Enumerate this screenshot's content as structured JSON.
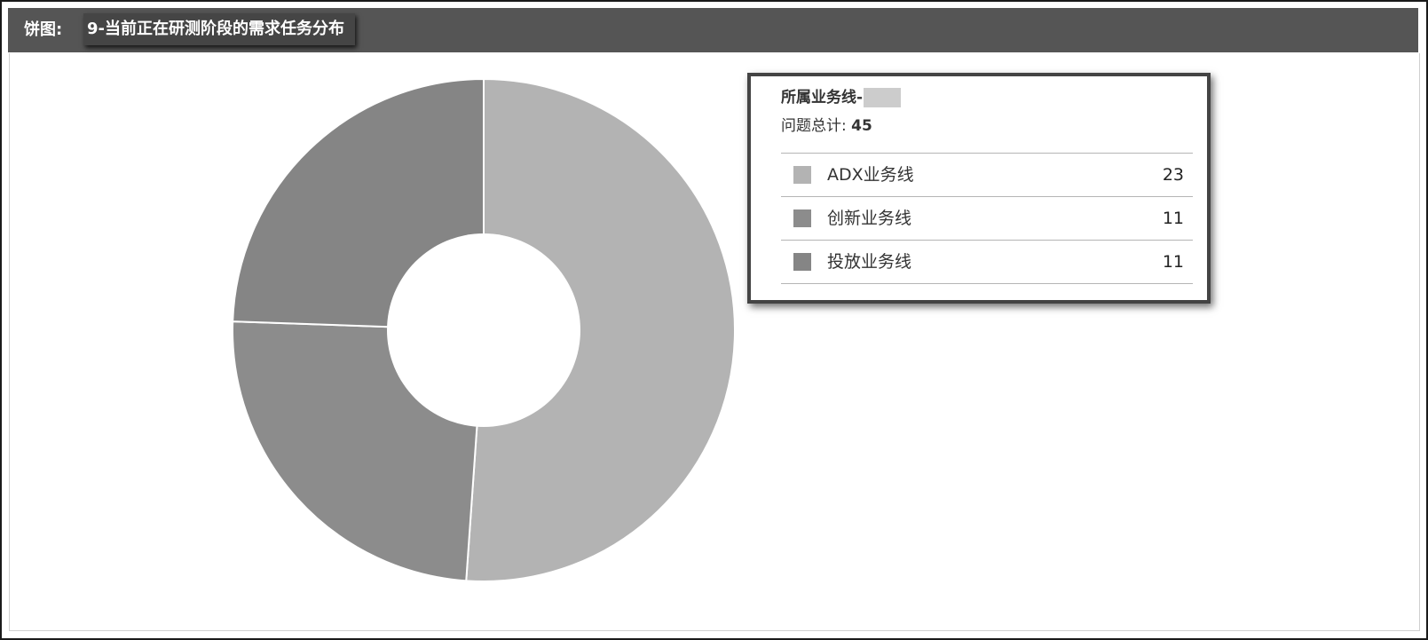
{
  "header": {
    "prefix": "饼图:",
    "title": "9-当前正在研测阶段的需求任务分布"
  },
  "tooltip": {
    "group_label": "所属业务线-",
    "total_label": "问题总计:",
    "total_value": "45"
  },
  "chart_data": {
    "type": "pie",
    "categories": [
      "ADX业务线",
      "创新业务线",
      "投放业务线"
    ],
    "values": [
      23,
      11,
      11
    ],
    "colors": [
      "#b3b3b3",
      "#8c8c8c",
      "#858585"
    ],
    "hole": true
  }
}
